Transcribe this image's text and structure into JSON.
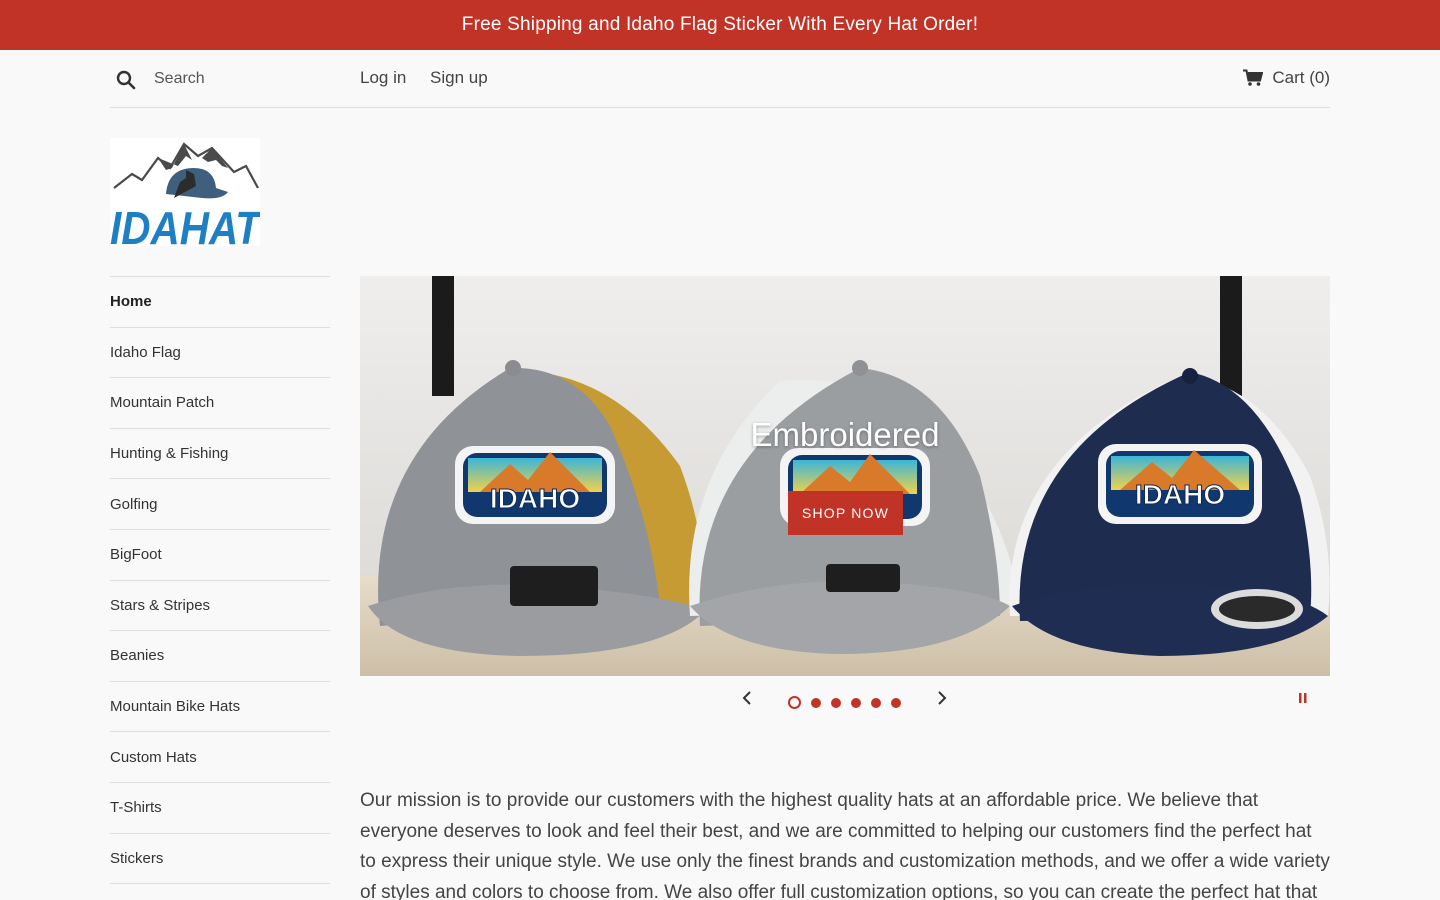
{
  "announcement": "Free Shipping and Idaho Flag Sticker With Every Hat Order!",
  "header": {
    "search_placeholder": "Search",
    "login": "Log in",
    "signup": "Sign up",
    "cart": "Cart (0)"
  },
  "logo": {
    "text": "IDAHAT"
  },
  "sidebar": {
    "items": [
      {
        "label": "Home",
        "active": true
      },
      {
        "label": "Idaho Flag"
      },
      {
        "label": "Mountain Patch"
      },
      {
        "label": "Hunting & Fishing"
      },
      {
        "label": "Golfing"
      },
      {
        "label": "BigFoot"
      },
      {
        "label": "Stars & Stripes"
      },
      {
        "label": "Beanies"
      },
      {
        "label": "Mountain Bike Hats"
      },
      {
        "label": "Custom Hats"
      },
      {
        "label": "T-Shirts"
      },
      {
        "label": "Stickers"
      }
    ]
  },
  "slideshow": {
    "title": "Embroidered",
    "button": "SHOP NOW",
    "slide_count": 6,
    "active_slide": 1,
    "patch_text": "IDAHO"
  },
  "mission_text": "Our mission is to provide our customers with the highest quality hats at an affordable price. We believe that everyone deserves to look and feel their best, and we are committed to helping our customers find the perfect hat to express their unique style. We use only the finest brands and customization methods, and we offer a wide variety of styles and colors to choose from. We also offer full customization options, so you can create the perfect hat that is just right for",
  "colors": {
    "accent": "#c23327",
    "background": "#f9f9f9",
    "logo_blue": "#1f7fc4"
  }
}
